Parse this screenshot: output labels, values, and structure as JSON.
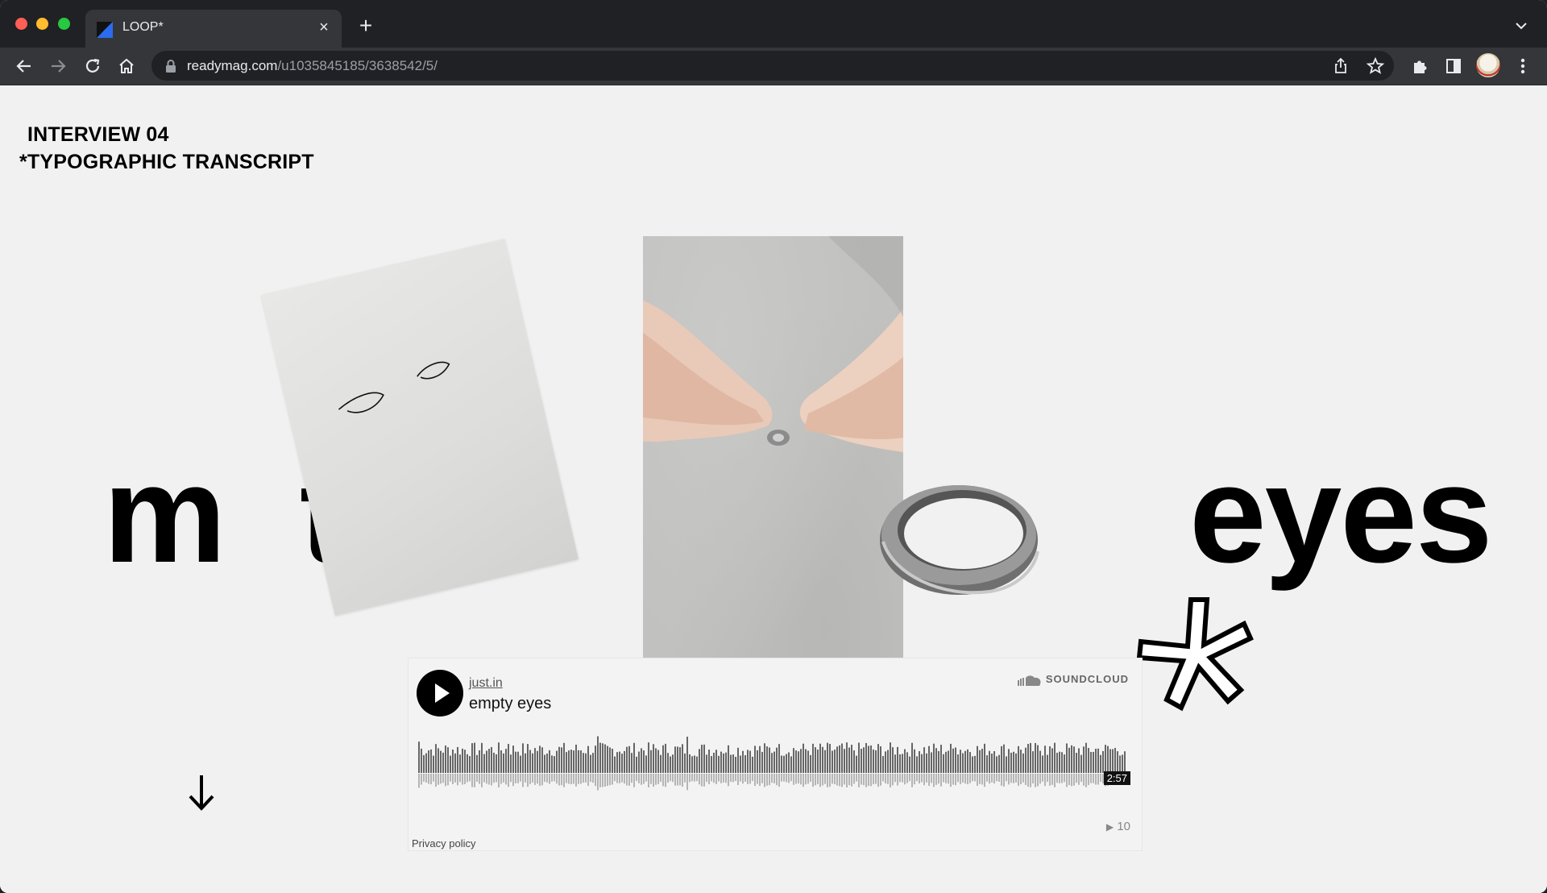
{
  "browser": {
    "tab_title": "LOOP*",
    "tab_close": "×",
    "new_tab": "+",
    "url_host": "readymag.com",
    "url_path": "/u1035845185/3638542/5/"
  },
  "page": {
    "heading_line1": "INTERVIEW 04",
    "heading_line2": "*TYPOGRAPHIC TRANSCRIPT",
    "word_m": "m",
    "word_t": "t",
    "word_eyes": "eyes"
  },
  "soundcloud": {
    "user": "just.in",
    "track": "empty eyes",
    "brand": "SOUNDCLOUD",
    "duration": "2:57",
    "plays": "10",
    "privacy": "Privacy policy"
  },
  "colors": {
    "page_bg": "#f1f1f1",
    "chrome_dark": "#202124",
    "chrome_toolbar": "#35363a"
  }
}
